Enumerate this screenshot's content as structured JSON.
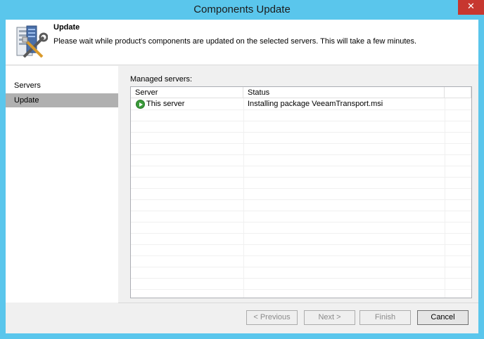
{
  "window": {
    "title": "Components Update",
    "close_glyph": "✕"
  },
  "header": {
    "title": "Update",
    "description": "Please wait while product's components are updated on the selected servers. This will take a few minutes.",
    "icon": "server-tools-icon"
  },
  "sidebar": {
    "items": [
      {
        "label": "Servers",
        "active": false
      },
      {
        "label": "Update",
        "active": true
      }
    ]
  },
  "main": {
    "label": "Managed servers:",
    "columns": [
      "Server",
      "Status"
    ],
    "rows": [
      {
        "server": "This server",
        "status": "Installing package VeeamTransport.msi",
        "icon": "play-icon"
      }
    ]
  },
  "buttons": {
    "previous": "< Previous",
    "next": "Next >",
    "finish": "Finish",
    "cancel": "Cancel"
  },
  "colors": {
    "window_frame": "#5ac6ec",
    "close": "#c7372f",
    "status_icon": "#3a9a3a"
  }
}
